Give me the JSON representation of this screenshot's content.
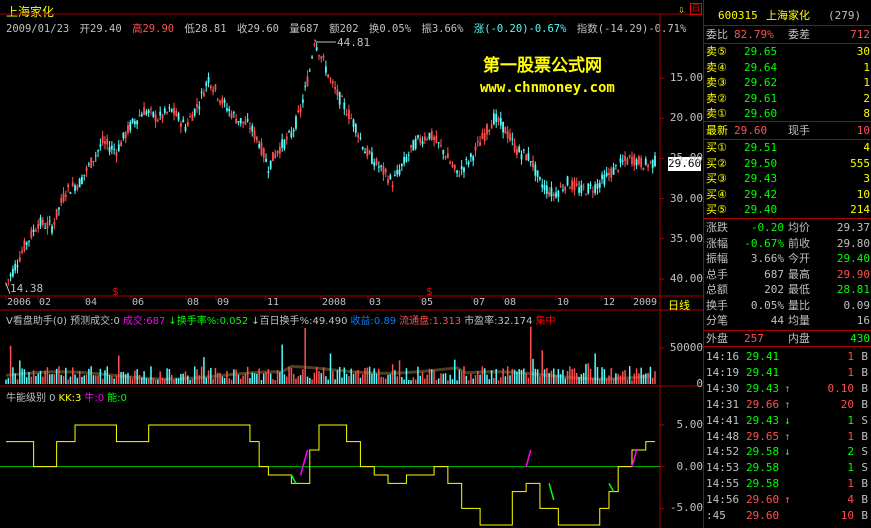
{
  "header": {
    "stock_name": "上海家化",
    "date": "2009/01/23",
    "open_label": "开29.40",
    "high_label": "高29.90",
    "low_label": "低28.81",
    "close_label": "收29.60",
    "volume_label": "量687",
    "amount_label": "额202",
    "turnover_label": "换0.05%",
    "amplitude_label": "振3.66%",
    "change_label": "涨(-0.20)-0.67%",
    "index_label": "指数(-14.29)-0.71%"
  },
  "watermark": {
    "line1": "第一股票公式网",
    "line2": "www.chnmoney.com"
  },
  "main_chart": {
    "y_ticks": [
      "40.00",
      "35.00",
      "30.00",
      "25.00",
      "20.00",
      "15.00"
    ],
    "high_marker": "44.81",
    "low_marker": "14.38",
    "current_price": "29.60",
    "x_ticks": [
      "2006",
      "02",
      "04",
      "06",
      "08",
      "09",
      "11",
      "2008",
      "03",
      "05",
      "07",
      "08",
      "10",
      "12",
      "2009"
    ],
    "period_label": "日线",
    "colors": {
      "up": "#ff5050",
      "down": "#54fcfc"
    }
  },
  "volume_panel": {
    "title_parts": [
      {
        "text": "V看盘助手(0) 预测成交:0",
        "color": "#c0c0c0"
      },
      {
        "text": "成交:687",
        "color": "#ff00ff"
      },
      {
        "text": "↓换手率%:0.052",
        "color": "#00ff00"
      },
      {
        "text": "↓百日换手%:49.490",
        "color": "#c0c0c0"
      },
      {
        "text": "收益:0.89",
        "color": "#0080ff"
      },
      {
        "text": "流通盘:1.313",
        "color": "#ff5050"
      },
      {
        "text": "市盈率:32.174",
        "color": "#c0c0c0"
      },
      {
        "text": "集中",
        "color": "#ff0000"
      }
    ],
    "y_ticks": [
      "50000",
      "0"
    ]
  },
  "indicator_panel": {
    "title_parts": [
      {
        "text": "牛能级别 0",
        "color": "#c0c0c0"
      },
      {
        "text": "KK:3",
        "color": "#ffff00"
      },
      {
        "text": "牛:0",
        "color": "#ff00ff"
      },
      {
        "text": "能:0",
        "color": "#00ff00"
      }
    ],
    "y_ticks": [
      "5.00",
      "0.00",
      "-5.00"
    ]
  },
  "quote": {
    "code": "600315",
    "name": "上海家化",
    "number": "(279)",
    "weibi_label": "委比",
    "weibi_value": "82.79%",
    "weicha_label": "委差",
    "weicha_value": "712",
    "sells": [
      {
        "label": "卖⑤",
        "price": "29.65",
        "vol": "30"
      },
      {
        "label": "卖④",
        "price": "29.64",
        "vol": "1"
      },
      {
        "label": "卖③",
        "price": "29.62",
        "vol": "1"
      },
      {
        "label": "卖②",
        "price": "29.61",
        "vol": "2"
      },
      {
        "label": "卖①",
        "price": "29.60",
        "vol": "8"
      }
    ],
    "latest_label": "最新",
    "latest_value": "29.60",
    "xianshou_label": "现手",
    "xianshou_value": "10",
    "buys": [
      {
        "label": "买①",
        "price": "29.51",
        "vol": "4"
      },
      {
        "label": "买②",
        "price": "29.50",
        "vol": "555"
      },
      {
        "label": "买③",
        "price": "29.43",
        "vol": "3"
      },
      {
        "label": "买④",
        "price": "29.42",
        "vol": "10"
      },
      {
        "label": "买⑤",
        "price": "29.40",
        "vol": "214"
      }
    ],
    "stats": [
      {
        "l1": "涨跌",
        "v1": "-0.20",
        "l2": "均价",
        "v2": "29.37",
        "c1": "#00ff00",
        "c2": "#c0c0c0"
      },
      {
        "l1": "涨幅",
        "v1": "-0.67%",
        "l2": "前收",
        "v2": "29.80",
        "c1": "#00ff00",
        "c2": "#c0c0c0"
      },
      {
        "l1": "振幅",
        "v1": "3.66%",
        "l2": "今开",
        "v2": "29.40",
        "c1": "#c0c0c0",
        "c2": "#00ff00"
      },
      {
        "l1": "总手",
        "v1": "687",
        "l2": "最高",
        "v2": "29.90",
        "c1": "#c0c0c0",
        "c2": "#ff5050"
      },
      {
        "l1": "总额",
        "v1": "202",
        "l2": "最低",
        "v2": "28.81",
        "c1": "#c0c0c0",
        "c2": "#00ff00"
      },
      {
        "l1": "换手",
        "v1": "0.05%",
        "l2": "量比",
        "v2": "0.09",
        "c1": "#c0c0c0",
        "c2": "#c0c0c0"
      },
      {
        "l1": "分笔",
        "v1": "44",
        "l2": "均量",
        "v2": "16",
        "c1": "#c0c0c0",
        "c2": "#c0c0c0"
      }
    ],
    "waipan_label": "外盘",
    "waipan_value": "257",
    "neipan_label": "内盘",
    "neipan_value": "430",
    "ticks": [
      {
        "time": "14:16",
        "price": "29.41",
        "arrow": "",
        "vol": "1",
        "side": "B",
        "pc": "#00ff00",
        "vc": "#ff5050"
      },
      {
        "time": "14:19",
        "price": "29.41",
        "arrow": "",
        "vol": "1",
        "side": "B",
        "pc": "#00ff00",
        "vc": "#ff5050"
      },
      {
        "time": "14:30",
        "price": "29.43",
        "arrow": "↑",
        "vol": "0.10",
        "side": "B",
        "pc": "#00ff00",
        "vc": "#ff5050"
      },
      {
        "time": "14:31",
        "price": "29.66",
        "arrow": "↑",
        "vol": "20",
        "side": "B",
        "pc": "#ff5050",
        "vc": "#ff5050"
      },
      {
        "time": "14:41",
        "price": "29.43",
        "arrow": "↓",
        "vol": "1",
        "side": "S",
        "pc": "#00ff00",
        "vc": "#00ff00"
      },
      {
        "time": "14:48",
        "price": "29.65",
        "arrow": "↑",
        "vol": "1",
        "side": "B",
        "pc": "#ff5050",
        "vc": "#ff5050"
      },
      {
        "time": "14:52",
        "price": "29.58",
        "arrow": "↓",
        "vol": "2",
        "side": "S",
        "pc": "#00ff00",
        "vc": "#00ff00"
      },
      {
        "time": "14:53",
        "price": "29.58",
        "arrow": "",
        "vol": "1",
        "side": "S",
        "pc": "#00ff00",
        "vc": "#00ff00"
      },
      {
        "time": "14:55",
        "price": "29.58",
        "arrow": "",
        "vol": "1",
        "side": "B",
        "pc": "#00ff00",
        "vc": "#ff5050"
      },
      {
        "time": "14:56",
        "price": "29.60",
        "arrow": "↑",
        "vol": "4",
        "side": "B",
        "pc": "#ff5050",
        "vc": "#ff5050"
      },
      {
        "time": ":45",
        "price": "29.60",
        "arrow": "",
        "vol": "10",
        "side": "B",
        "pc": "#ff5050",
        "vc": "#ff5050"
      }
    ]
  },
  "chart_data": {
    "type": "line",
    "x_ticks": [
      "2006",
      "02",
      "04",
      "06",
      "08",
      "09",
      "11",
      "2008",
      "03",
      "05",
      "07",
      "08",
      "10",
      "12",
      "2009"
    ],
    "y_ticks": [
      15,
      20,
      25,
      30,
      35,
      40
    ],
    "ylim": [
      13,
      45.5
    ],
    "series": [
      {
        "points": [
          [
            0,
            14.4
          ],
          [
            3,
            16
          ],
          [
            8,
            19
          ],
          [
            14,
            22
          ],
          [
            20,
            21.5
          ],
          [
            26,
            26
          ],
          [
            32,
            27
          ],
          [
            38,
            30
          ],
          [
            42,
            32
          ],
          [
            48,
            31
          ],
          [
            54,
            34
          ],
          [
            60,
            36
          ],
          [
            66,
            35
          ],
          [
            72,
            36
          ],
          [
            78,
            34
          ],
          [
            84,
            37
          ],
          [
            88,
            40
          ],
          [
            94,
            37
          ],
          [
            100,
            35
          ],
          [
            106,
            34
          ],
          [
            110,
            32
          ],
          [
            114,
            29
          ],
          [
            118,
            31
          ],
          [
            124,
            33
          ],
          [
            128,
            36
          ],
          [
            132,
            41
          ],
          [
            134,
            44.8
          ],
          [
            138,
            42
          ],
          [
            142,
            39
          ],
          [
            148,
            36
          ],
          [
            152,
            34
          ],
          [
            156,
            31
          ],
          [
            162,
            29
          ],
          [
            168,
            27
          ],
          [
            174,
            30
          ],
          [
            178,
            32
          ],
          [
            184,
            33
          ],
          [
            190,
            31
          ],
          [
            196,
            28
          ],
          [
            202,
            30
          ],
          [
            208,
            33
          ],
          [
            212,
            35
          ],
          [
            216,
            34
          ],
          [
            222,
            31
          ],
          [
            228,
            30
          ],
          [
            232,
            27
          ],
          [
            238,
            25.5
          ],
          [
            244,
            27
          ],
          [
            250,
            26
          ],
          [
            256,
            26.5
          ],
          [
            262,
            28
          ],
          [
            268,
            29.5
          ],
          [
            272,
            30
          ],
          [
            278,
            29.2
          ],
          [
            282,
            29.6
          ]
        ]
      }
    ],
    "indicator": {
      "ylim": [
        -7,
        8
      ],
      "y_ticks": [
        5,
        0,
        -5
      ],
      "kk_points": [
        [
          0,
          3
        ],
        [
          8,
          3
        ],
        [
          12,
          0
        ],
        [
          18,
          0
        ],
        [
          22,
          3
        ],
        [
          30,
          5
        ],
        [
          36,
          5
        ],
        [
          42,
          5
        ],
        [
          48,
          3
        ],
        [
          58,
          3
        ],
        [
          62,
          5
        ],
        [
          72,
          5
        ],
        [
          80,
          5
        ],
        [
          86,
          5
        ],
        [
          92,
          5
        ],
        [
          100,
          5
        ],
        [
          106,
          3
        ],
        [
          110,
          0
        ],
        [
          114,
          -1
        ],
        [
          120,
          -1
        ],
        [
          124,
          -2
        ],
        [
          128,
          -2
        ],
        [
          132,
          2
        ],
        [
          136,
          5
        ],
        [
          142,
          5
        ],
        [
          148,
          3
        ],
        [
          154,
          0
        ],
        [
          160,
          -1
        ],
        [
          166,
          -2
        ],
        [
          174,
          -1
        ],
        [
          180,
          -1
        ],
        [
          186,
          0
        ],
        [
          192,
          -2
        ],
        [
          198,
          -5
        ],
        [
          206,
          -7
        ],
        [
          214,
          -7
        ],
        [
          220,
          -3
        ],
        [
          226,
          -2
        ],
        [
          232,
          -5
        ],
        [
          240,
          -7
        ],
        [
          250,
          -7
        ],
        [
          258,
          -5
        ],
        [
          262,
          -3
        ],
        [
          266,
          0
        ],
        [
          272,
          2
        ],
        [
          278,
          3
        ],
        [
          282,
          3
        ]
      ],
      "niu_points": [
        [
          128,
          -1
        ],
        [
          131,
          2
        ],
        [
          226,
          0
        ],
        [
          228,
          2
        ],
        [
          272,
          0
        ],
        [
          274,
          2
        ]
      ],
      "neng_points": [
        [
          124,
          -1
        ],
        [
          126,
          -2
        ],
        [
          236,
          -2
        ],
        [
          238,
          -4
        ],
        [
          262,
          -2
        ],
        [
          264,
          -3
        ]
      ]
    }
  }
}
